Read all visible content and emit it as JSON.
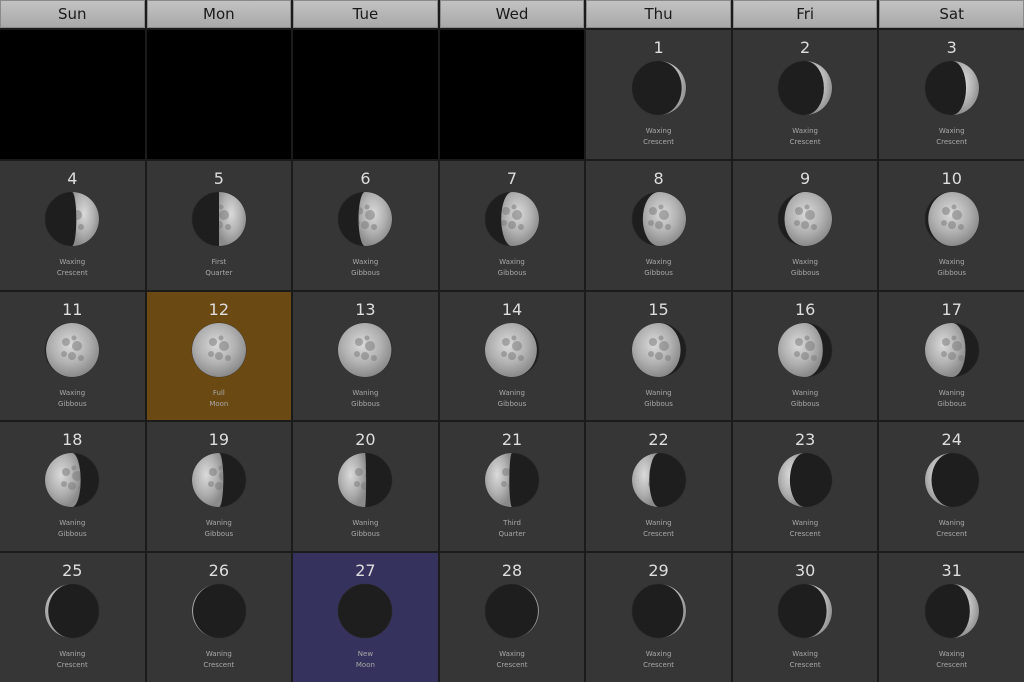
{
  "weekdays": [
    "Sun",
    "Mon",
    "Tue",
    "Wed",
    "Thu",
    "Fri",
    "Sat"
  ],
  "leading_blank_days": 4,
  "colors": {
    "cell": "#363636",
    "empty": "#000000",
    "full_moon_highlight": "#6b4913",
    "new_moon_highlight": "#35335e",
    "moon_lit": "#b5b5b5",
    "moon_dark": "#1e1e1e"
  },
  "days": [
    {
      "day": "1",
      "phase1": "Waxing",
      "phase2": "Crescent",
      "illumination": 0.08,
      "waxing": true,
      "highlight": ""
    },
    {
      "day": "2",
      "phase1": "Waxing",
      "phase2": "Crescent",
      "illumination": 0.15,
      "waxing": true,
      "highlight": ""
    },
    {
      "day": "3",
      "phase1": "Waxing",
      "phase2": "Crescent",
      "illumination": 0.24,
      "waxing": true,
      "highlight": ""
    },
    {
      "day": "4",
      "phase1": "Waxing",
      "phase2": "Crescent",
      "illumination": 0.42,
      "waxing": true,
      "highlight": ""
    },
    {
      "day": "5",
      "phase1": "First",
      "phase2": "Quarter",
      "illumination": 0.5,
      "waxing": true,
      "highlight": ""
    },
    {
      "day": "6",
      "phase1": "Waxing",
      "phase2": "Gibbous",
      "illumination": 0.62,
      "waxing": true,
      "highlight": ""
    },
    {
      "day": "7",
      "phase1": "Waxing",
      "phase2": "Gibbous",
      "illumination": 0.7,
      "waxing": true,
      "highlight": ""
    },
    {
      "day": "8",
      "phase1": "Waxing",
      "phase2": "Gibbous",
      "illumination": 0.8,
      "waxing": true,
      "highlight": ""
    },
    {
      "day": "9",
      "phase1": "Waxing",
      "phase2": "Gibbous",
      "illumination": 0.88,
      "waxing": true,
      "highlight": ""
    },
    {
      "day": "10",
      "phase1": "Waxing",
      "phase2": "Gibbous",
      "illumination": 0.94,
      "waxing": true,
      "highlight": ""
    },
    {
      "day": "11",
      "phase1": "Waxing",
      "phase2": "Gibbous",
      "illumination": 0.98,
      "waxing": true,
      "highlight": ""
    },
    {
      "day": "12",
      "phase1": "Full",
      "phase2": "Moon",
      "illumination": 1.0,
      "waxing": true,
      "highlight": "full"
    },
    {
      "day": "13",
      "phase1": "Waning",
      "phase2": "Gibbous",
      "illumination": 0.99,
      "waxing": false,
      "highlight": ""
    },
    {
      "day": "14",
      "phase1": "Waning",
      "phase2": "Gibbous",
      "illumination": 0.96,
      "waxing": false,
      "highlight": ""
    },
    {
      "day": "15",
      "phase1": "Waning",
      "phase2": "Gibbous",
      "illumination": 0.9,
      "waxing": false,
      "highlight": ""
    },
    {
      "day": "16",
      "phase1": "Waning",
      "phase2": "Gibbous",
      "illumination": 0.83,
      "waxing": false,
      "highlight": ""
    },
    {
      "day": "17",
      "phase1": "Waning",
      "phase2": "Gibbous",
      "illumination": 0.75,
      "waxing": false,
      "highlight": ""
    },
    {
      "day": "18",
      "phase1": "Waning",
      "phase2": "Gibbous",
      "illumination": 0.66,
      "waxing": false,
      "highlight": ""
    },
    {
      "day": "19",
      "phase1": "Waning",
      "phase2": "Gibbous",
      "illumination": 0.58,
      "waxing": false,
      "highlight": ""
    },
    {
      "day": "20",
      "phase1": "Waning",
      "phase2": "Gibbous",
      "illumination": 0.52,
      "waxing": false,
      "highlight": ""
    },
    {
      "day": "21",
      "phase1": "Third",
      "phase2": "Quarter",
      "illumination": 0.45,
      "waxing": false,
      "highlight": ""
    },
    {
      "day": "22",
      "phase1": "Waning",
      "phase2": "Crescent",
      "illumination": 0.32,
      "waxing": false,
      "highlight": ""
    },
    {
      "day": "23",
      "phase1": "Waning",
      "phase2": "Crescent",
      "illumination": 0.22,
      "waxing": false,
      "highlight": ""
    },
    {
      "day": "24",
      "phase1": "Waning",
      "phase2": "Crescent",
      "illumination": 0.12,
      "waxing": false,
      "highlight": ""
    },
    {
      "day": "25",
      "phase1": "Waning",
      "phase2": "Crescent",
      "illumination": 0.06,
      "waxing": false,
      "highlight": ""
    },
    {
      "day": "26",
      "phase1": "Waning",
      "phase2": "Crescent",
      "illumination": 0.02,
      "waxing": false,
      "highlight": ""
    },
    {
      "day": "27",
      "phase1": "New",
      "phase2": "Moon",
      "illumination": 0.0,
      "waxing": true,
      "highlight": "new"
    },
    {
      "day": "28",
      "phase1": "Waxing",
      "phase2": "Crescent",
      "illumination": 0.02,
      "waxing": true,
      "highlight": ""
    },
    {
      "day": "29",
      "phase1": "Waxing",
      "phase2": "Crescent",
      "illumination": 0.05,
      "waxing": true,
      "highlight": ""
    },
    {
      "day": "30",
      "phase1": "Waxing",
      "phase2": "Crescent",
      "illumination": 0.1,
      "waxing": true,
      "highlight": ""
    },
    {
      "day": "31",
      "phase1": "Waxing",
      "phase2": "Crescent",
      "illumination": 0.17,
      "waxing": true,
      "highlight": ""
    }
  ]
}
